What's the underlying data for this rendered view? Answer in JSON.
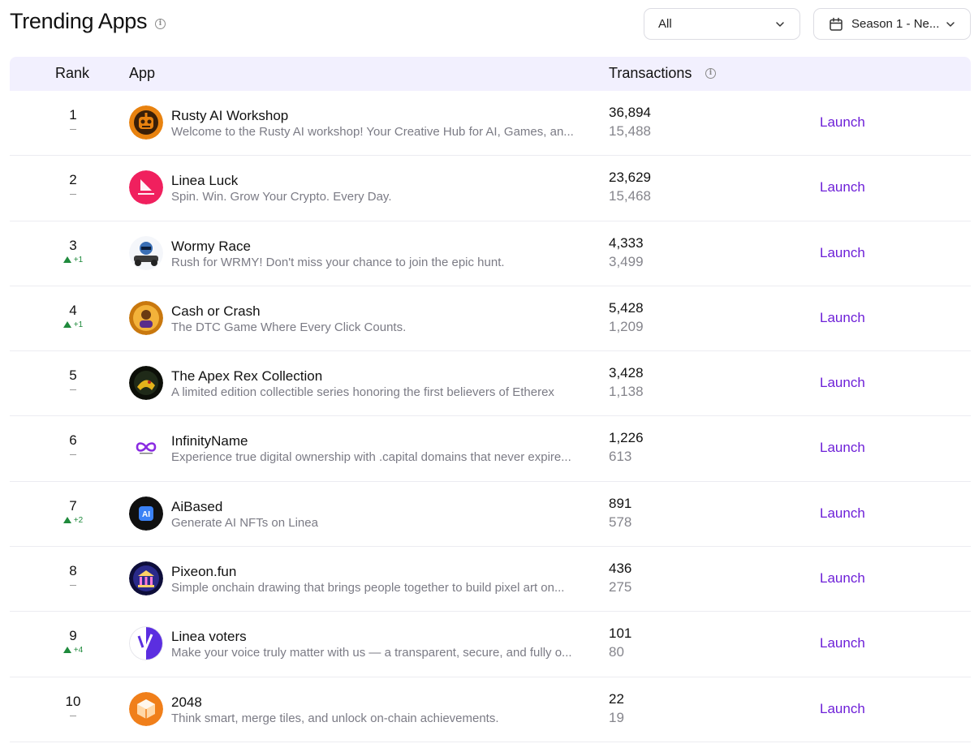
{
  "header": {
    "title": "Trending Apps",
    "title_info_icon": "info-icon",
    "filter": {
      "value": "All",
      "icon": "chevron-down-icon"
    },
    "season": {
      "value": "Season 1 - Ne...",
      "icon": "calendar-icon",
      "chevron": "chevron-down-icon"
    }
  },
  "table": {
    "columns": {
      "rank": "Rank",
      "app": "App",
      "transactions": "Transactions"
    },
    "action_label": "Launch",
    "rows": [
      {
        "rank": "1",
        "change": "",
        "change_dir": "none",
        "name": "Rusty AI Workshop",
        "description": "Welcome to the Rusty AI workshop! Your Creative Hub for AI, Games, an...",
        "tx_main": "36,894",
        "tx_sub": "15,488",
        "logo": "robot-face-logo",
        "logo_color": "#e8820f"
      },
      {
        "rank": "2",
        "change": "",
        "change_dir": "none",
        "name": "Linea Luck",
        "description": "Spin. Win. Grow Your Crypto. Every Day.",
        "tx_main": "23,629",
        "tx_sub": "15,468",
        "logo": "linea-luck-logo",
        "logo_color": "#f0205e"
      },
      {
        "rank": "3",
        "change": "+1",
        "change_dir": "up",
        "name": "Wormy Race",
        "description": "Rush for WRMY! Don't miss your chance to join the epic hunt.",
        "tx_main": "4,333",
        "tx_sub": "3,499",
        "logo": "worm-racer-logo",
        "logo_color": "#3a6fb5"
      },
      {
        "rank": "4",
        "change": "+1",
        "change_dir": "up",
        "name": "Cash or Crash",
        "description": "The DTC Game Where Every Click Counts.",
        "tx_main": "5,428",
        "tx_sub": "1,209",
        "logo": "cash-or-crash-logo",
        "logo_color": "#c9780e"
      },
      {
        "rank": "5",
        "change": "",
        "change_dir": "none",
        "name": "The Apex Rex Collection",
        "description": "A limited edition collectible series honoring the first believers of Etherex",
        "tx_main": "3,428",
        "tx_sub": "1,138",
        "logo": "apex-rex-logo",
        "logo_color": "#1f2a18"
      },
      {
        "rank": "6",
        "change": "",
        "change_dir": "none",
        "name": "InfinityName",
        "description": "Experience true digital ownership with .capital domains that never expire...",
        "tx_main": "1,226",
        "tx_sub": "613",
        "logo": "infinity-logo",
        "logo_color": "#8a2be2"
      },
      {
        "rank": "7",
        "change": "+2",
        "change_dir": "up",
        "name": "AiBased",
        "description": "Generate AI NFTs on Linea",
        "tx_main": "891",
        "tx_sub": "578",
        "logo": "ai-chip-logo",
        "logo_color": "#3b82f6"
      },
      {
        "rank": "8",
        "change": "",
        "change_dir": "none",
        "name": "Pixeon.fun",
        "description": "Simple onchain drawing that brings people together to build pixel art on...",
        "tx_main": "436",
        "tx_sub": "275",
        "logo": "pixel-temple-logo",
        "logo_color": "#2a2a8a"
      },
      {
        "rank": "9",
        "change": "+4",
        "change_dir": "up",
        "name": "Linea voters",
        "description": "Make your voice truly matter with us — a transparent, secure, and fully o...",
        "tx_main": "101",
        "tx_sub": "80",
        "logo": "v-check-logo",
        "logo_color": "#5b2ee0"
      },
      {
        "rank": "10",
        "change": "",
        "change_dir": "none",
        "name": "2048",
        "description": "Think smart, merge tiles, and unlock on-chain achievements.",
        "tx_main": "22",
        "tx_sub": "19",
        "logo": "cube-2048-logo",
        "logo_color": "#f07f1a"
      }
    ]
  }
}
